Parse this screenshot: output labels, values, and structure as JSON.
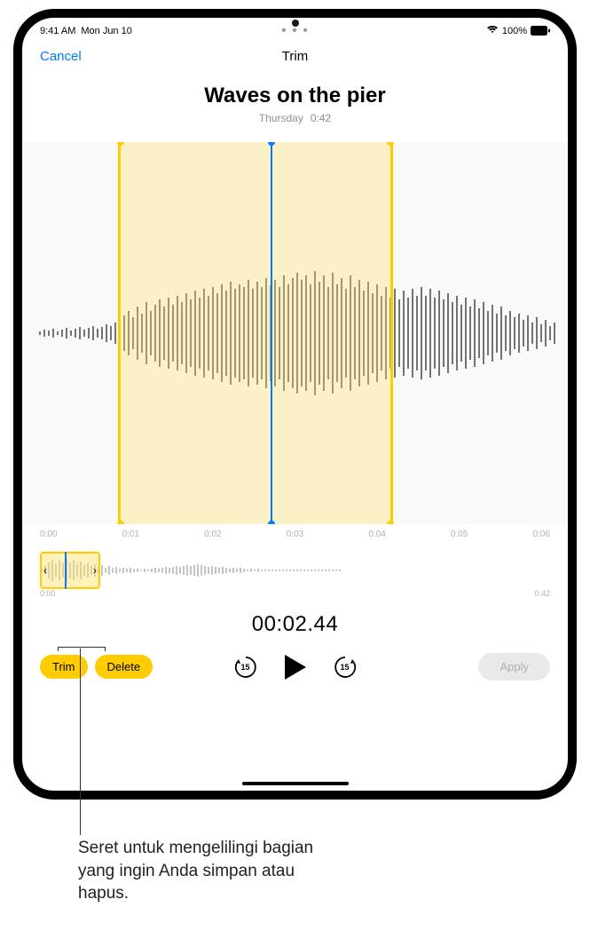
{
  "status": {
    "time": "9:41 AM",
    "date": "Mon Jun 10",
    "battery_pct": "100%"
  },
  "nav": {
    "cancel": "Cancel",
    "title": "Trim"
  },
  "recording": {
    "title": "Waves on the pier",
    "day": "Thursday",
    "duration": "0:42"
  },
  "ruler": {
    "t0": "0:00",
    "t1": "0:01",
    "t2": "0:02",
    "t3": "0:03",
    "t4": "0:04",
    "t5": "0:05",
    "t6": "0:06"
  },
  "overview": {
    "start": "0:00",
    "end": "0:42"
  },
  "current_time": "00:02.44",
  "buttons": {
    "trim": "Trim",
    "delete": "Delete",
    "apply": "Apply",
    "skip_back": "15",
    "skip_fwd": "15"
  },
  "callout": "Seret untuk mengelilingi bagian yang ingin Anda simpan atau hapus."
}
